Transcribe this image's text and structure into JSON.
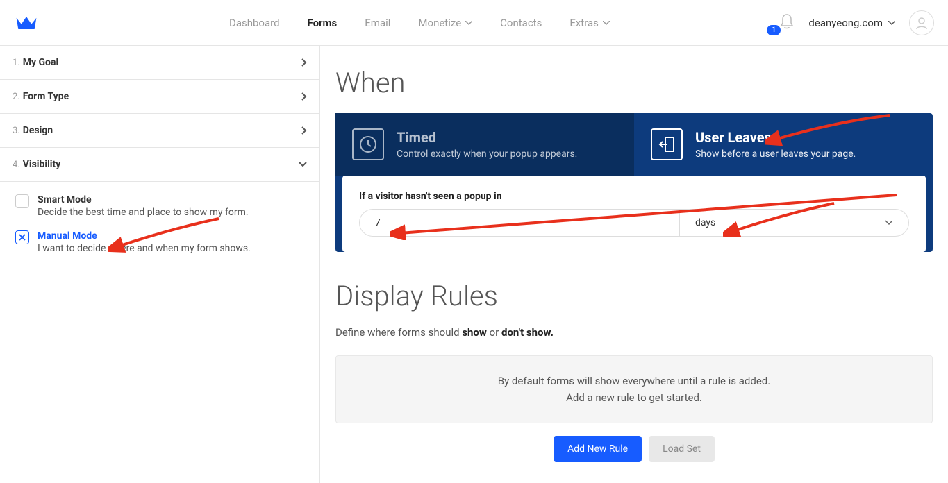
{
  "nav": {
    "items": [
      {
        "label": "Dashboard",
        "active": false,
        "chevron": false
      },
      {
        "label": "Forms",
        "active": true,
        "chevron": false
      },
      {
        "label": "Email",
        "active": false,
        "chevron": false
      },
      {
        "label": "Monetize",
        "active": false,
        "chevron": true
      },
      {
        "label": "Contacts",
        "active": false,
        "chevron": false
      },
      {
        "label": "Extras",
        "active": false,
        "chevron": true
      }
    ]
  },
  "notifications": {
    "count": "1"
  },
  "account": {
    "domain": "deanyeong.com"
  },
  "sidebar": {
    "steps": [
      {
        "num": "1.",
        "title": "My Goal"
      },
      {
        "num": "2.",
        "title": "Form Type"
      },
      {
        "num": "3.",
        "title": "Design"
      },
      {
        "num": "4.",
        "title": "Visibility"
      }
    ],
    "visibility": {
      "smart": {
        "title": "Smart Mode",
        "desc": "Decide the best time and place to show my form."
      },
      "manual": {
        "title": "Manual Mode",
        "desc": "I want to decide where and when my form shows."
      }
    }
  },
  "when": {
    "heading": "When",
    "tabs": {
      "timed": {
        "title": "Timed",
        "desc": "Control exactly when your popup appears."
      },
      "leaves": {
        "title": "User Leaves",
        "desc": "Show before a user leaves your page."
      }
    },
    "condition": {
      "label": "If a visitor hasn't seen a popup in",
      "value": "7",
      "unit": "days"
    }
  },
  "rules": {
    "heading": "Display Rules",
    "sub_pre": "Define where forms should ",
    "sub_show": "show",
    "sub_mid": " or ",
    "sub_dont": "don't show.",
    "box_line1": "By default forms will show everywhere until a rule is added.",
    "box_line2": "Add a new rule to get started.",
    "add_btn": "Add New Rule",
    "load_btn": "Load Set"
  }
}
